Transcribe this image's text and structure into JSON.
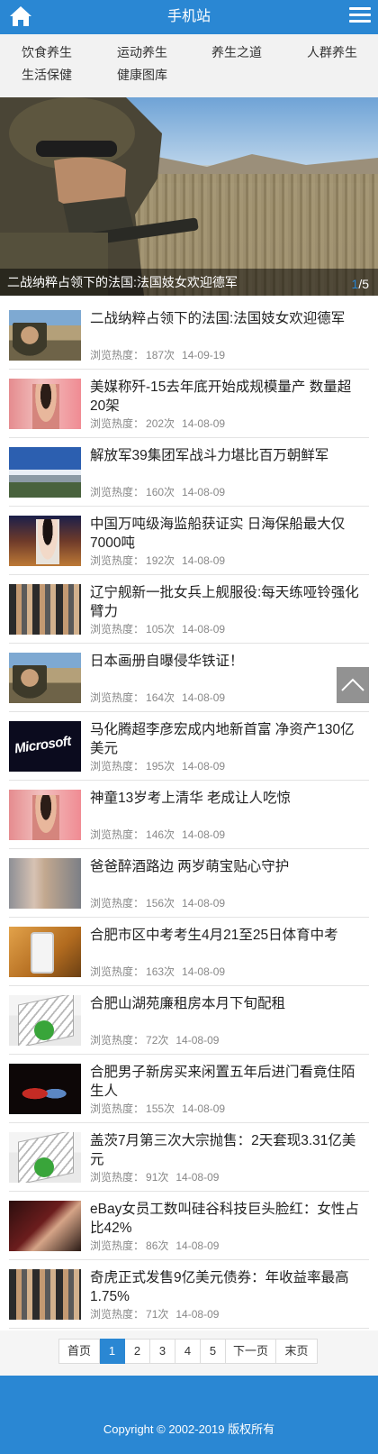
{
  "header": {
    "title": "手机站",
    "home_icon": "home-icon",
    "menu_icon": "menu-icon",
    "color": "#2a87d3"
  },
  "categories": [
    "饮食养生",
    "运动养生",
    "养生之道",
    "人群养生",
    "生活保健",
    "健康图库"
  ],
  "banner": {
    "caption": "二战纳粹占领下的法国:法国妓女欢迎德军",
    "current": "1",
    "total": "/5"
  },
  "news": [
    {
      "title": "二战纳粹占领下的法国:法国妓女欢迎德军",
      "views_label": "浏览热度：",
      "views": "187次",
      "date": "14-09-19",
      "thumb": "soldier"
    },
    {
      "title": "美媒称歼-15去年底开始成规模量产 数量超20架",
      "views_label": "浏览热度：",
      "views": "202次",
      "date": "14-08-09",
      "thumb": "woman"
    },
    {
      "title": "解放军39集团军战斗力堪比百万朝鲜军",
      "views_label": "浏览热度：",
      "views": "160次",
      "date": "14-08-09",
      "thumb": "city"
    },
    {
      "title": "中国万吨级海监船获证实 日海保船最大仅7000吨",
      "views_label": "浏览热度：",
      "views": "192次",
      "date": "14-08-09",
      "thumb": "harbor"
    },
    {
      "title": "辽宁舰新一批女兵上舰服役:每天练哑铃强化臂力",
      "views_label": "浏览热度：",
      "views": "105次",
      "date": "14-08-09",
      "thumb": "crowd"
    },
    {
      "title": "日本画册自曝侵华铁证！",
      "views_label": "浏览热度：",
      "views": "164次",
      "date": "14-08-09",
      "thumb": "soldier"
    },
    {
      "title": "马化腾超李彦宏成内地新首富 净资产130亿美元",
      "views_label": "浏览热度：",
      "views": "195次",
      "date": "14-08-09",
      "thumb": "ms"
    },
    {
      "title": "神童13岁考上清华 老成让人吃惊",
      "views_label": "浏览热度：",
      "views": "146次",
      "date": "14-08-09",
      "thumb": "woman"
    },
    {
      "title": "爸爸醉酒路边 两岁萌宝贴心守护",
      "views_label": "浏览热度：",
      "views": "156次",
      "date": "14-08-09",
      "thumb": "gym"
    },
    {
      "title": "合肥市区中考考生4月21至25日体育中考",
      "views_label": "浏览热度：",
      "views": "163次",
      "date": "14-08-09",
      "thumb": "phone"
    },
    {
      "title": "合肥山湖苑廉租房本月下旬配租",
      "views_label": "浏览热度：",
      "views": "72次",
      "date": "14-08-09",
      "thumb": "bldg"
    },
    {
      "title": "合肥男子新房买来闲置五年后进门看竟住陌生人",
      "views_label": "浏览热度：",
      "views": "155次",
      "date": "14-08-09",
      "thumb": "stage"
    },
    {
      "title": "盖茨7月第三次大宗抛售：2天套现3.31亿美元",
      "views_label": "浏览热度：",
      "views": "91次",
      "date": "14-08-09",
      "thumb": "bldg"
    },
    {
      "title": "eBay女员工数叫硅谷科技巨头脸红：女性占比42%",
      "views_label": "浏览热度：",
      "views": "86次",
      "date": "14-08-09",
      "thumb": "party"
    },
    {
      "title": "奇虎正式发售9亿美元债券：年收益率最高1.75%",
      "views_label": "浏览热度：",
      "views": "71次",
      "date": "14-08-09",
      "thumb": "crowd"
    }
  ],
  "ms_logo_text": "Microsoft",
  "pagination": {
    "first": "首页",
    "pages": [
      "1",
      "2",
      "3",
      "4",
      "5"
    ],
    "active": "1",
    "next": "下一页",
    "last": "末页"
  },
  "footer": {
    "copyright": "Copyright © 2002-2019 版权所有"
  }
}
